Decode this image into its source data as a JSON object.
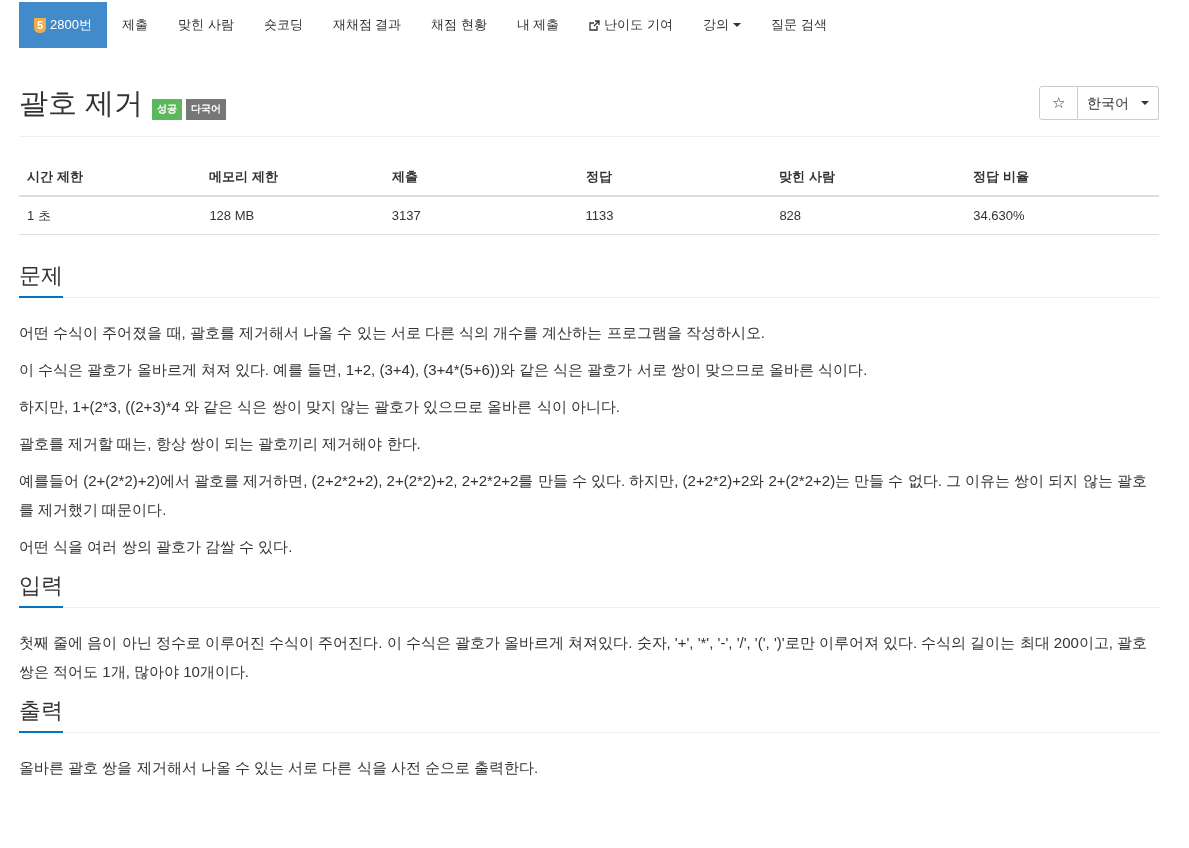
{
  "nav": {
    "tabs": [
      {
        "label": "2800번",
        "badge": "5",
        "selected": true
      },
      {
        "label": "제출",
        "selected": false
      },
      {
        "label": "맞힌 사람",
        "selected": false
      },
      {
        "label": "숏코딩",
        "selected": false
      },
      {
        "label": "재채점 결과",
        "selected": false
      },
      {
        "label": "채점 현황",
        "selected": false
      },
      {
        "label": "내 제출",
        "selected": false
      },
      {
        "label": "난이도 기여",
        "kind": "external",
        "selected": false
      },
      {
        "label": "강의",
        "kind": "dropdown",
        "selected": false
      },
      {
        "label": "질문 검색",
        "selected": false
      }
    ]
  },
  "title": "괄호 제거",
  "labels": [
    {
      "text": "성공",
      "color": "#5cb85c"
    },
    {
      "text": "다국어",
      "color": "#777777"
    }
  ],
  "star_button": "☆",
  "language": "한국어",
  "info_table": {
    "columns": [
      "시간 제한",
      "메모리 제한",
      "제출",
      "정답",
      "맞힌 사람",
      "정답 비율"
    ],
    "rows": [
      [
        "1 초",
        "128 MB",
        "3137",
        "1133",
        "828",
        "34.630%"
      ]
    ]
  },
  "sections": [
    {
      "heading": "문제",
      "paragraphs": [
        "어떤 수식이 주어졌을 때, 괄호를 제거해서 나올 수 있는 서로 다른 식의 개수를 계산하는 프로그램을 작성하시오.",
        "이 수식은 괄호가 올바르게 쳐져 있다. 예를 들면, 1+2, (3+4), (3+4*(5+6))와 같은 식은 괄호가 서로 쌍이 맞으므로 올바른 식이다.",
        "하지만, 1+(2*3, ((2+3)*4 와 같은 식은 쌍이 맞지 않는 괄호가 있으므로 올바른 식이 아니다.",
        "괄호를 제거할 때는, 항상 쌍이 되는 괄호끼리 제거해야 한다.",
        "예를들어 (2+(2*2)+2)에서 괄호를 제거하면, (2+2*2+2), 2+(2*2)+2, 2+2*2+2를 만들 수 있다. 하지만, (2+2*2)+2와 2+(2*2+2)는 만들 수 없다. 그 이유는 쌍이 되지 않는 괄호를 제거했기 때문이다.",
        "어떤 식을 여러 쌍의 괄호가 감쌀 수 있다."
      ]
    },
    {
      "heading": "입력",
      "paragraphs": [
        "첫째 줄에 음이 아닌 정수로 이루어진 수식이 주어진다. 이 수식은 괄호가 올바르게 쳐져있다. 숫자, '+', '*', '-', '/', '(', ')'로만 이루어져 있다. 수식의 길이는 최대 200이고, 괄호 쌍은 적어도 1개, 많아야 10개이다."
      ]
    },
    {
      "heading": "출력",
      "paragraphs": [
        "올바른 괄호 쌍을 제거해서 나올 수 있는 서로 다른 식을 사전 순으로 출력한다."
      ]
    }
  ]
}
